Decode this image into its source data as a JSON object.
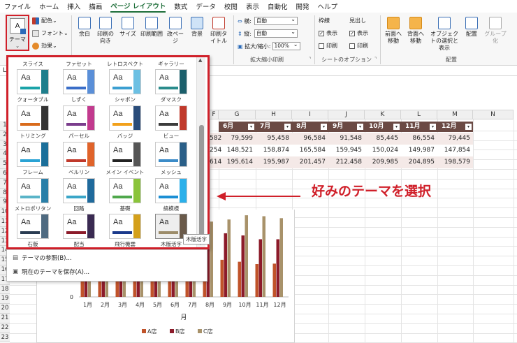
{
  "menu": {
    "tabs": [
      "ファイル",
      "ホーム",
      "挿入",
      "描画",
      "ページ レイアウト",
      "数式",
      "データ",
      "校閲",
      "表示",
      "自動化",
      "開発",
      "ヘルプ"
    ],
    "active": "ページ レイアウト"
  },
  "ribbon": {
    "theme_label": "テーマ",
    "colors_label": "配色",
    "fonts_label": "フォント",
    "effects_label": "効果",
    "margins_label": "余白",
    "orientation_label": "印刷の向き",
    "size_label": "サイズ",
    "print_area_label": "印刷範囲",
    "breaks_label": "改ページ",
    "background_label": "背景",
    "print_titles_label": "印刷タイトル",
    "width_label": "横:",
    "width_value": "自動",
    "height_label": "縦:",
    "height_value": "自動",
    "scale_label": "拡大/縮小:",
    "scale_value": "100%",
    "scale_group_label": "拡大縮小印刷",
    "gridlines_label": "枠線",
    "headings_label": "見出し",
    "view_label": "表示",
    "print_label": "印刷",
    "sheet_options_label": "シートのオプション",
    "bring_forward_label": "前面へ移動",
    "send_backward_label": "背面へ移動",
    "selection_pane_label": "オブジェクトの選択と表示",
    "align_label": "配置",
    "group_label": "グループ化",
    "arrange_label": "配置"
  },
  "gallery": {
    "top_row_labels": [
      "スライス",
      "ファセット",
      "レトロスペクト",
      "ギャラリー"
    ],
    "themes": [
      {
        "name": "クォータブル",
        "accent": "#1aa3a8",
        "side": "#1e7e8c"
      },
      {
        "name": "しずく",
        "accent": "#3a6ec8",
        "side": "#5a8fd8"
      },
      {
        "name": "シャボン",
        "accent": "#3b9fd1",
        "side": "#6cc0e3"
      },
      {
        "name": "ダマスク",
        "accent": "#2a8c8c",
        "side": "#1b5f6b"
      },
      {
        "name": "トリミング",
        "accent": "#d96b1b",
        "side": "#333333"
      },
      {
        "name": "パーセル",
        "accent": "#7a3d8c",
        "side": "#c23a8e"
      },
      {
        "name": "バッジ",
        "accent": "#f2a11b",
        "side": "#2a4c7a"
      },
      {
        "name": "ビュー",
        "accent": "#3c3c3c",
        "side": "#c0392b"
      },
      {
        "name": "フレーム",
        "accent": "#2aa3d4",
        "side": "#1b6f9a"
      },
      {
        "name": "ベルリン",
        "accent": "#c0392b",
        "side": "#e0632a"
      },
      {
        "name": "メイン イベント",
        "accent": "#222222",
        "side": "#555555"
      },
      {
        "name": "メッシュ",
        "accent": "#3c8cc8",
        "side": "#2a5f88"
      },
      {
        "name": "メトロポリタン",
        "accent": "#5ab4c8",
        "side": "#2a7fa8"
      },
      {
        "name": "回路",
        "accent": "#3aa6c8",
        "side": "#1f6a9c"
      },
      {
        "name": "基礎",
        "accent": "#4fa84c",
        "side": "#8ac43a"
      },
      {
        "name": "縞模様",
        "accent": "#1b8fd4",
        "side": "#2bb0ea"
      },
      {
        "name": "石版",
        "accent": "#2a3c52",
        "side": "#4f6a80"
      },
      {
        "name": "配当",
        "accent": "#8c1b2a",
        "side": "#3a2a52"
      },
      {
        "name": "飛行機雲",
        "accent": "#1b3a8c",
        "side": "#d4a01b"
      },
      {
        "name": "木版活字",
        "accent": "#9c8c6a",
        "side": "#6a5a4a"
      }
    ],
    "tooltip": "木版活字",
    "browse_label": "テーマの参照(B)...",
    "save_label": "現在のテーマを保存(A)..."
  },
  "callout": "好みのテーマを選択",
  "sheet": {
    "columns": [
      "F",
      "G",
      "H",
      "I",
      "J",
      "K",
      "L",
      "M",
      "N"
    ],
    "rows": [
      "1",
      "2",
      "3",
      "4",
      "5",
      "6",
      "7",
      "8",
      "9",
      "10",
      "11",
      "12",
      "13",
      "14",
      "15",
      "16",
      "17",
      "18",
      "19",
      "20",
      "21",
      "22",
      "23"
    ],
    "header_cells": [
      "6月",
      "7月",
      "8月",
      "9月",
      "10月",
      "11月",
      "12月"
    ],
    "data_rows": [
      [
        "582",
        "79,599",
        "95,458",
        "96,584",
        "91,548",
        "85,445",
        "86,554",
        "79,445"
      ],
      [
        "254",
        "148,521",
        "158,874",
        "165,584",
        "159,945",
        "150,024",
        "149,987",
        "147,854"
      ],
      [
        "614",
        "195,614",
        "195,987",
        "201,457",
        "212,458",
        "209,985",
        "204,895",
        "198,579"
      ]
    ],
    "row_header_left": "L"
  },
  "chart_data": {
    "type": "bar",
    "categories": [
      "1月",
      "2月",
      "3月",
      "4月",
      "5月",
      "6月",
      "7月",
      "8月",
      "9月",
      "10月",
      "11月",
      "12月"
    ],
    "series": [
      {
        "name": "A店",
        "color": "#c0532a",
        "values": [
          79000,
          80000,
          82000,
          81000,
          80500,
          79582,
          79599,
          95458,
          96584,
          91548,
          85445,
          86554
        ]
      },
      {
        "name": "B店",
        "color": "#8c1b2a",
        "values": [
          148000,
          149000,
          150000,
          149500,
          148800,
          148254,
          148521,
          158874,
          165584,
          159945,
          150024,
          149987
        ]
      },
      {
        "name": "C店",
        "color": "#a8926a",
        "values": [
          195000,
          196000,
          197000,
          196500,
          196000,
          195614,
          195614,
          195987,
          201457,
          212458,
          209985,
          204895
        ]
      }
    ],
    "xlabel": "月",
    "ylim": [
      0,
      220000
    ],
    "zero_label": "0",
    "legend": "bottom"
  }
}
